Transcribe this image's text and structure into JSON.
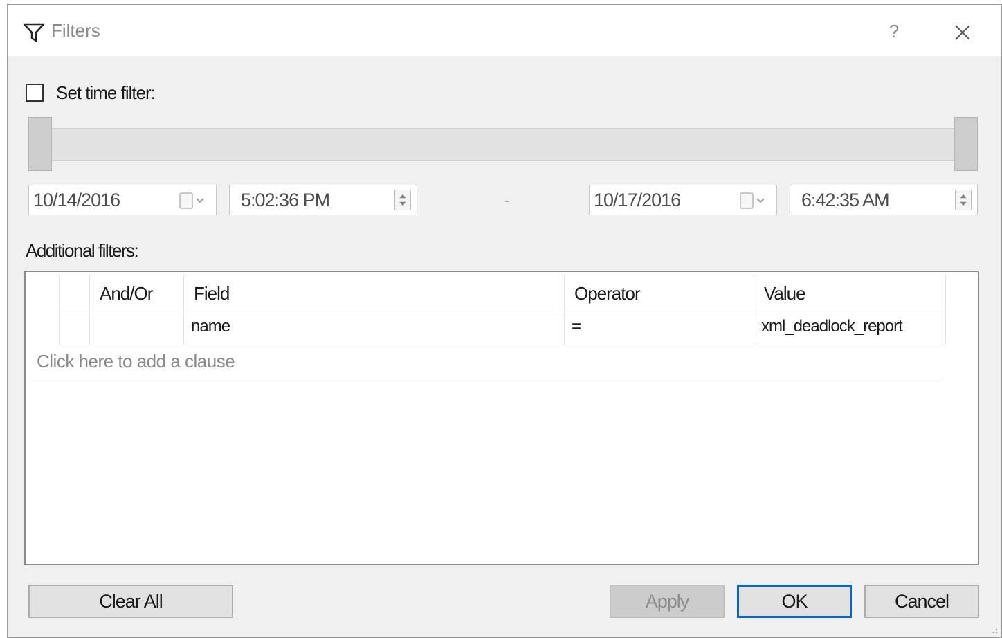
{
  "window": {
    "title": "Filters",
    "help_label": "?"
  },
  "time_filter": {
    "checkbox_label": "Set time filter:",
    "checked": false,
    "start_date": "10/14/2016",
    "start_time": "5:02:36 PM",
    "separator": "-",
    "end_date": "10/17/2016",
    "end_time": "6:42:35 AM"
  },
  "additional_filters": {
    "label": "Additional filters:",
    "columns": [
      "And/Or",
      "Field",
      "Operator",
      "Value"
    ],
    "rows": [
      {
        "and_or": "",
        "field": "name",
        "operator": "=",
        "value": "xml_deadlock_report"
      }
    ],
    "add_clause_text": "Click here to add a clause"
  },
  "buttons": {
    "clear_all": "Clear All",
    "apply": "Apply",
    "ok": "OK",
    "cancel": "Cancel"
  },
  "colors": {
    "dialog_bg": "#f0f0f0",
    "default_button_border": "#0a66c8",
    "disabled_button_bg": "#cccccc"
  },
  "icons": [
    "filter-icon",
    "help-icon",
    "close-icon",
    "calendar-dropdown-icon",
    "spin-updown-icon"
  ]
}
